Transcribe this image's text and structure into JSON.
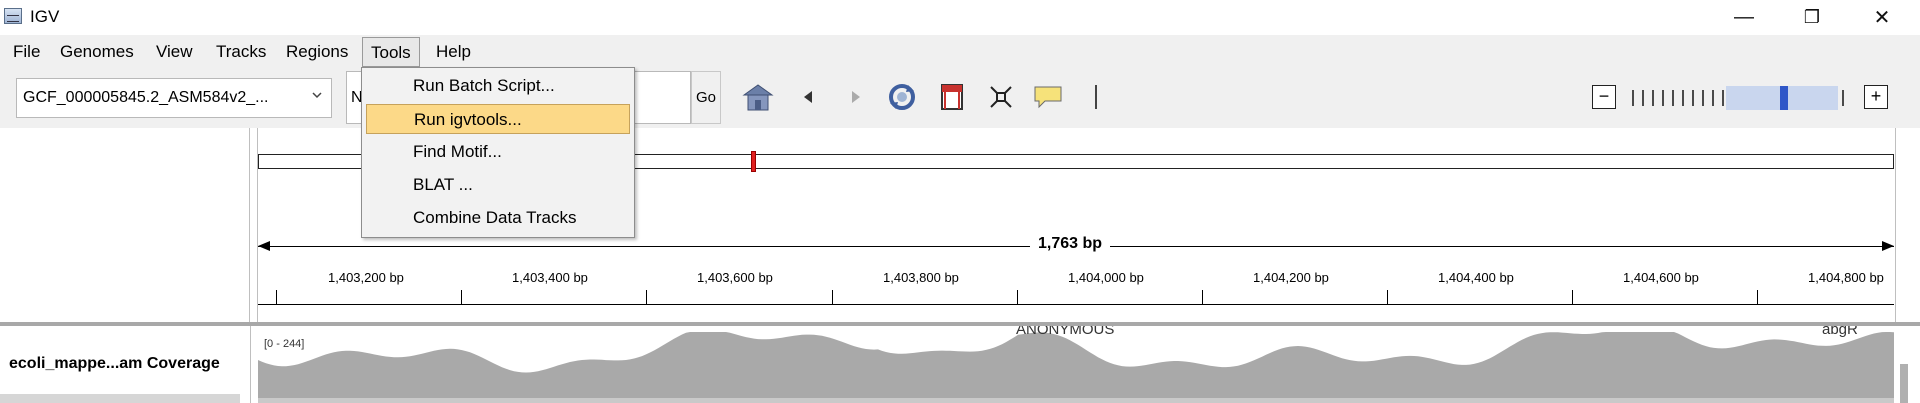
{
  "window": {
    "title": "IGV",
    "minimize_glyph": "—",
    "restore_glyph": "❐",
    "close_glyph": "✕"
  },
  "menubar": {
    "items": [
      "File",
      "Genomes",
      "View",
      "Tracks",
      "Regions",
      "Tools",
      "Help"
    ],
    "active": "Tools"
  },
  "toolbar": {
    "genome": "GCF_000005845.2_ASM584v2_...",
    "locus": "N",
    "go_label": "Go",
    "icons": [
      "home-icon",
      "back-icon",
      "forward-icon",
      "refresh-icon",
      "roi-icon",
      "fit-window-icon",
      "popup-info-icon",
      "resize-divider-icon"
    ],
    "zoom_minus": "−",
    "zoom_plus": "+",
    "zoom_level_fraction": 0.71
  },
  "tools_menu": {
    "items": [
      "Run Batch Script...",
      "Run igvtools...",
      "Find Motif...",
      "BLAT ...",
      "Combine Data Tracks"
    ],
    "highlighted": "Run igvtools..."
  },
  "ruler": {
    "span_label": "1,763 bp",
    "ticks": [
      "1,403,200 bp",
      "1,403,400 bp",
      "1,403,600 bp",
      "1,403,800 bp",
      "1,404,000 bp",
      "1,404,200 bp",
      "1,404,400 bp",
      "1,404,600 bp",
      "1,404,800 bp"
    ]
  },
  "tracks": {
    "coverage_name": "ecoli_mappe...am Coverage",
    "data_range": "[0 - 244]",
    "feature_label": "ANONYMOUS",
    "gene_label": "abgR"
  },
  "colors": {
    "coverage": "#a9a9a9",
    "highlight": "#fcd988",
    "chrom_marker": "#e12020",
    "zoom_thumb": "#2f57c8"
  }
}
